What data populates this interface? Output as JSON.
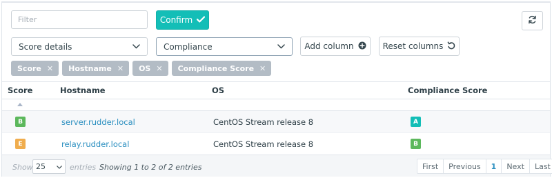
{
  "toolbar": {
    "filter_placeholder": "Filter",
    "confirm_label": "Confirm",
    "refresh_icon": "refresh-icon",
    "score_select": "Score details",
    "compliance_select": "Compliance",
    "add_column_label": "Add column",
    "reset_columns_label": "Reset columns"
  },
  "tags": [
    "Score",
    "Hostname",
    "OS",
    "Compliance Score"
  ],
  "table": {
    "headers": {
      "score": "Score",
      "hostname": "Hostname",
      "os": "OS",
      "compliance": "Compliance Score"
    },
    "rows": [
      {
        "score": "B",
        "score_color": "#5cb85c",
        "hostname": "server.rudder.local",
        "os": "CentOS Stream release 8",
        "compliance": "A",
        "compliance_color": "#13beb7"
      },
      {
        "score": "E",
        "score_color": "#f0ad4e",
        "hostname": "relay.rudder.local",
        "os": "CentOS Stream release 8",
        "compliance": "B",
        "compliance_color": "#5cb85c"
      }
    ]
  },
  "footer": {
    "show": "Show",
    "page_length": "25",
    "entries": "entries",
    "info": "Showing 1 to 2 of 2 entries",
    "pager": {
      "first": "First",
      "previous": "Previous",
      "current": "1",
      "next": "Next",
      "last": "Last"
    }
  },
  "colors": {
    "accent": "#13beb7",
    "link": "#2b8fc0",
    "tag_bg": "#b3bcc5"
  }
}
